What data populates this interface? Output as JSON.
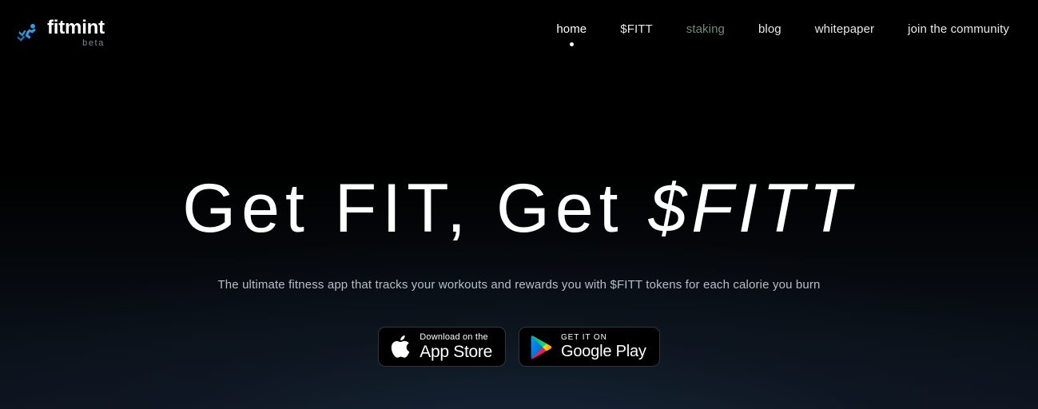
{
  "brand": {
    "name": "fitmint",
    "tag": "beta",
    "icon": "running-figure-icon",
    "icon_color": "#2f9bed"
  },
  "nav": {
    "items": [
      {
        "label": "home",
        "active": true,
        "accent": false
      },
      {
        "label": "$FITT",
        "active": false,
        "accent": false
      },
      {
        "label": "staking",
        "active": false,
        "accent": true
      },
      {
        "label": "blog",
        "active": false,
        "accent": false
      },
      {
        "label": "whitepaper",
        "active": false,
        "accent": false
      },
      {
        "label": "join the community",
        "active": false,
        "accent": false
      }
    ]
  },
  "hero": {
    "headline_plain": "Get FIT, Get ",
    "headline_accent": "$FITT",
    "subtitle": "The ultimate fitness app that tracks your workouts and rewards you with $FITT tokens for each calorie you burn"
  },
  "stores": {
    "apple": {
      "icon": "apple-logo-icon",
      "small": "Download on the",
      "large": "App Store"
    },
    "google": {
      "icon": "google-play-triangle-icon",
      "small": "GET IT ON",
      "large": "Google Play"
    }
  },
  "colors": {
    "background_top": "#000000",
    "background_bottom": "#0d1420",
    "text_primary": "#ffffff",
    "text_secondary": "#b9bec5",
    "nav_accent": "#6f8a78",
    "brand_blue": "#2f9bed"
  }
}
